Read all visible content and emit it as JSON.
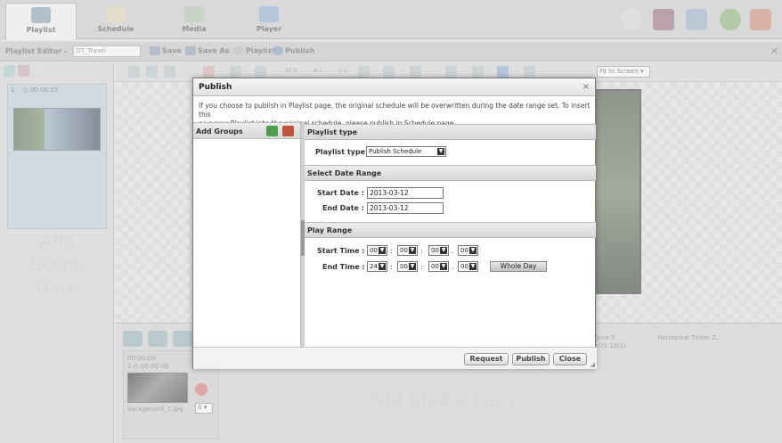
{
  "nav": {
    "tabs": [
      {
        "label": "Playlist",
        "icon": "playlist-icon"
      },
      {
        "label": "Schedule",
        "icon": "schedule-icon"
      },
      {
        "label": "Media",
        "icon": "media-icon"
      },
      {
        "label": "Player",
        "icon": "player-icon"
      }
    ],
    "right_icons": [
      "settings-icon",
      "layout-icon",
      "search-window-icon",
      "help-icon",
      "logout-icon"
    ]
  },
  "editor": {
    "title": "Playlist Editor -",
    "playlist_name": "DT_Travel",
    "save_label": "Save",
    "save_as_label": "Save As",
    "playlist_label": "Playlist",
    "publish_label": "Publish"
  },
  "scene": {
    "index": "1",
    "duration": "00:00:15",
    "add_label_1": "Add",
    "add_label_2": "Scene",
    "add_label_3": "Here"
  },
  "canvas": {
    "toolbar_labels": [
      "16:9",
      "4:3",
      "1:1"
    ],
    "fit_option": "Fit to Screen"
  },
  "timeline": {
    "media_time": "00:00:00",
    "media_index": "1",
    "media_start": "00:00:00",
    "media_file": "background_1.jpg",
    "media_count": "0",
    "add_media_label": "Add Media Here",
    "zone_name": "Zone 5",
    "zone_time": "0:00:15(1)",
    "ticker_label": "Horizontal Ticker Z..."
  },
  "modal": {
    "title": "Publish",
    "close_glyph": "×",
    "info_line1": "If you choose to publish in Playlist page, the original schedule will be overwritten during the date range set. To insert this",
    "info_line2": "as a new Playlist into the original schedule, please publish in Schedule page.",
    "groups_header": "Add Groups",
    "playlist_type_header": "Playlist type",
    "playlist_type_label": "Playlist type :",
    "playlist_type_value": "Publish Schedule",
    "date_range_header": "Select Date Range",
    "start_date_label": "Start Date :",
    "start_date_value": "2013-03-12",
    "end_date_label": "End Date :",
    "end_date_value": "2013-03-12",
    "play_range_header": "Play Range",
    "start_time_label": "Start Time :",
    "start_time": [
      "00",
      "00",
      "00",
      "00"
    ],
    "end_time_label": "End Time :",
    "end_time": [
      "24",
      "00",
      "00",
      "00"
    ],
    "whole_day_label": "Whole Day",
    "request_label": "Request",
    "publish_label": "Publish",
    "close_label": "Close"
  }
}
